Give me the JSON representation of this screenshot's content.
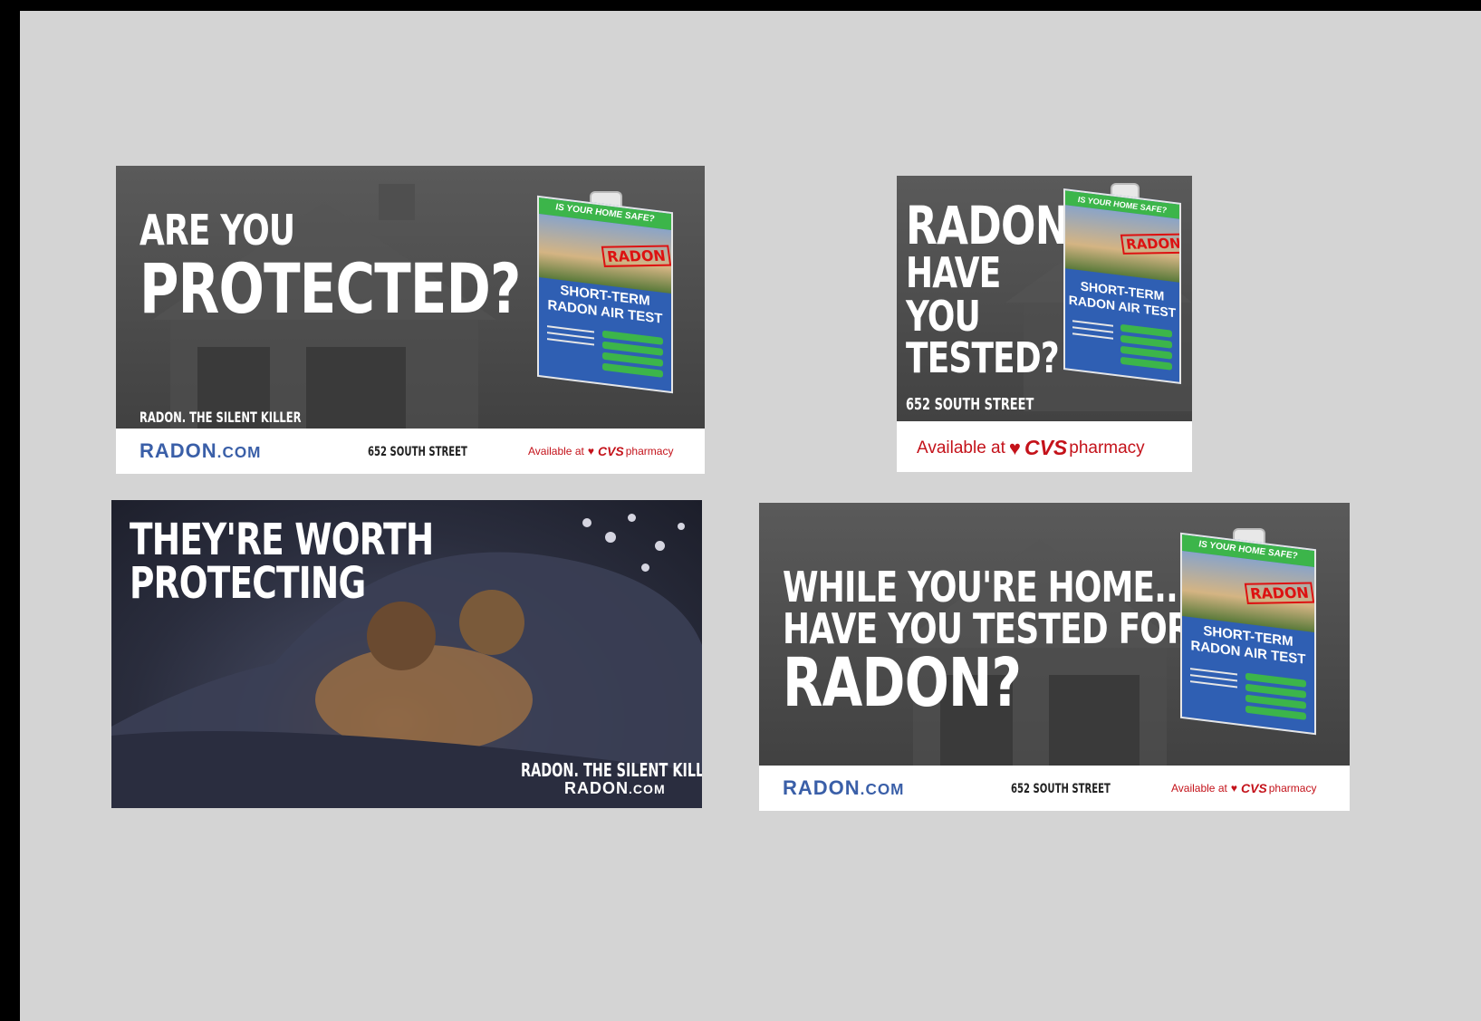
{
  "ads": {
    "ad1": {
      "headline_line1": "ARE YOU",
      "headline_line2": "PROTECTED?",
      "tagline": "RADON. THE SILENT KILLER",
      "brand_main": "RADON",
      "brand_suffix": ".com",
      "address": "652 SOUTH STREET",
      "available_text": "Available at",
      "cvs_text": "CVS",
      "pharmacy_text": "pharmacy"
    },
    "ad2": {
      "headline_line1": "RADON.",
      "headline_line2": "HAVE",
      "headline_line3": "YOU",
      "headline_line4": "TESTED?",
      "address": "652 SOUTH STREET",
      "available_text": "Available at",
      "cvs_text": "CVS",
      "pharmacy_text": "pharmacy"
    },
    "ad3": {
      "headline_line1": "THEY'RE WORTH",
      "headline_line2": "PROTECTING",
      "tagline": "RADON. THE SILENT KILLER",
      "brand_main": "RADON",
      "brand_suffix": ".com"
    },
    "ad4": {
      "headline_line1": "WHILE YOU'RE HOME...",
      "headline_line2": "HAVE YOU TESTED FOR",
      "headline_line3": "RADON?",
      "brand_main": "RADON",
      "brand_suffix": ".com",
      "address": "652 SOUTH STREET",
      "available_text": "Available at",
      "cvs_text": "CVS",
      "pharmacy_text": "pharmacy"
    }
  },
  "product_box": {
    "banner": "IS YOUR HOME SAFE?",
    "stamp": "RADON",
    "title_line1": "SHORT-TERM",
    "title_line2": "RADON AIR TEST"
  },
  "colors": {
    "brand_blue": "#3a5fa8",
    "cvs_red": "#c4121a",
    "box_blue": "#2f5fb3",
    "box_green": "#3cb54a",
    "ad_gray": "#4a4a4a",
    "page_bg": "#d4d4d4"
  },
  "icons": {
    "heart": "heart-icon"
  }
}
